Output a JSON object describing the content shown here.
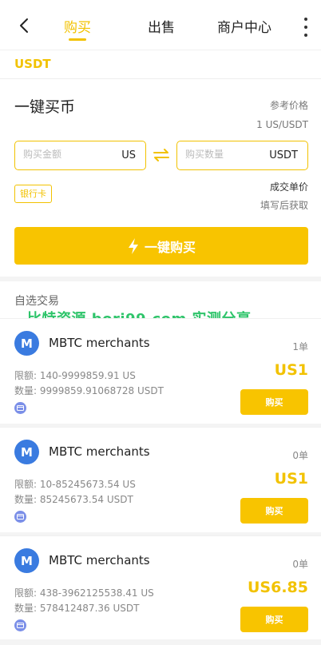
{
  "header": {
    "tabs": [
      {
        "label": "购买",
        "active": true
      },
      {
        "label": "出售",
        "active": false
      },
      {
        "label": "商户中心",
        "active": false
      }
    ]
  },
  "currency": "USDT",
  "quick_buy": {
    "title": "一键买币",
    "ref_price_label": "参考价格",
    "ref_price_value": "1 US/USDT",
    "amount_placeholder": "购买金额",
    "amount_unit": "US",
    "qty_placeholder": "购买数量",
    "qty_unit": "USDT",
    "payment_badge": "银行卡",
    "unit_price_label": "成交单价",
    "unit_price_hint": "填写后获取",
    "button_label": "一键购买"
  },
  "section": {
    "title": "自选交易",
    "watermark": "比特资源 bori99.com 实测分享"
  },
  "merchants": [
    {
      "avatar": "M",
      "name": "MBTC merchants",
      "orders": "1单",
      "limit": "限额: 140-9999859.91 US",
      "qty": "数量: 9999859.91068728 USDT",
      "price": "US1",
      "buy_label": "购买"
    },
    {
      "avatar": "M",
      "name": "MBTC merchants",
      "orders": "0单",
      "limit": "限额: 10-85245673.54 US",
      "qty": "数量: 85245673.54 USDT",
      "price": "US1",
      "buy_label": "购买"
    },
    {
      "avatar": "M",
      "name": "MBTC merchants",
      "orders": "0单",
      "limit": "限额: 438-3962125538.41 US",
      "qty": "数量: 578412487.36 USDT",
      "price": "US6.85",
      "buy_label": "购买"
    }
  ],
  "colors": {
    "accent": "#f2c200",
    "button": "#f8c400",
    "avatar": "#3a7be0",
    "watermark": "#2ec46a"
  }
}
